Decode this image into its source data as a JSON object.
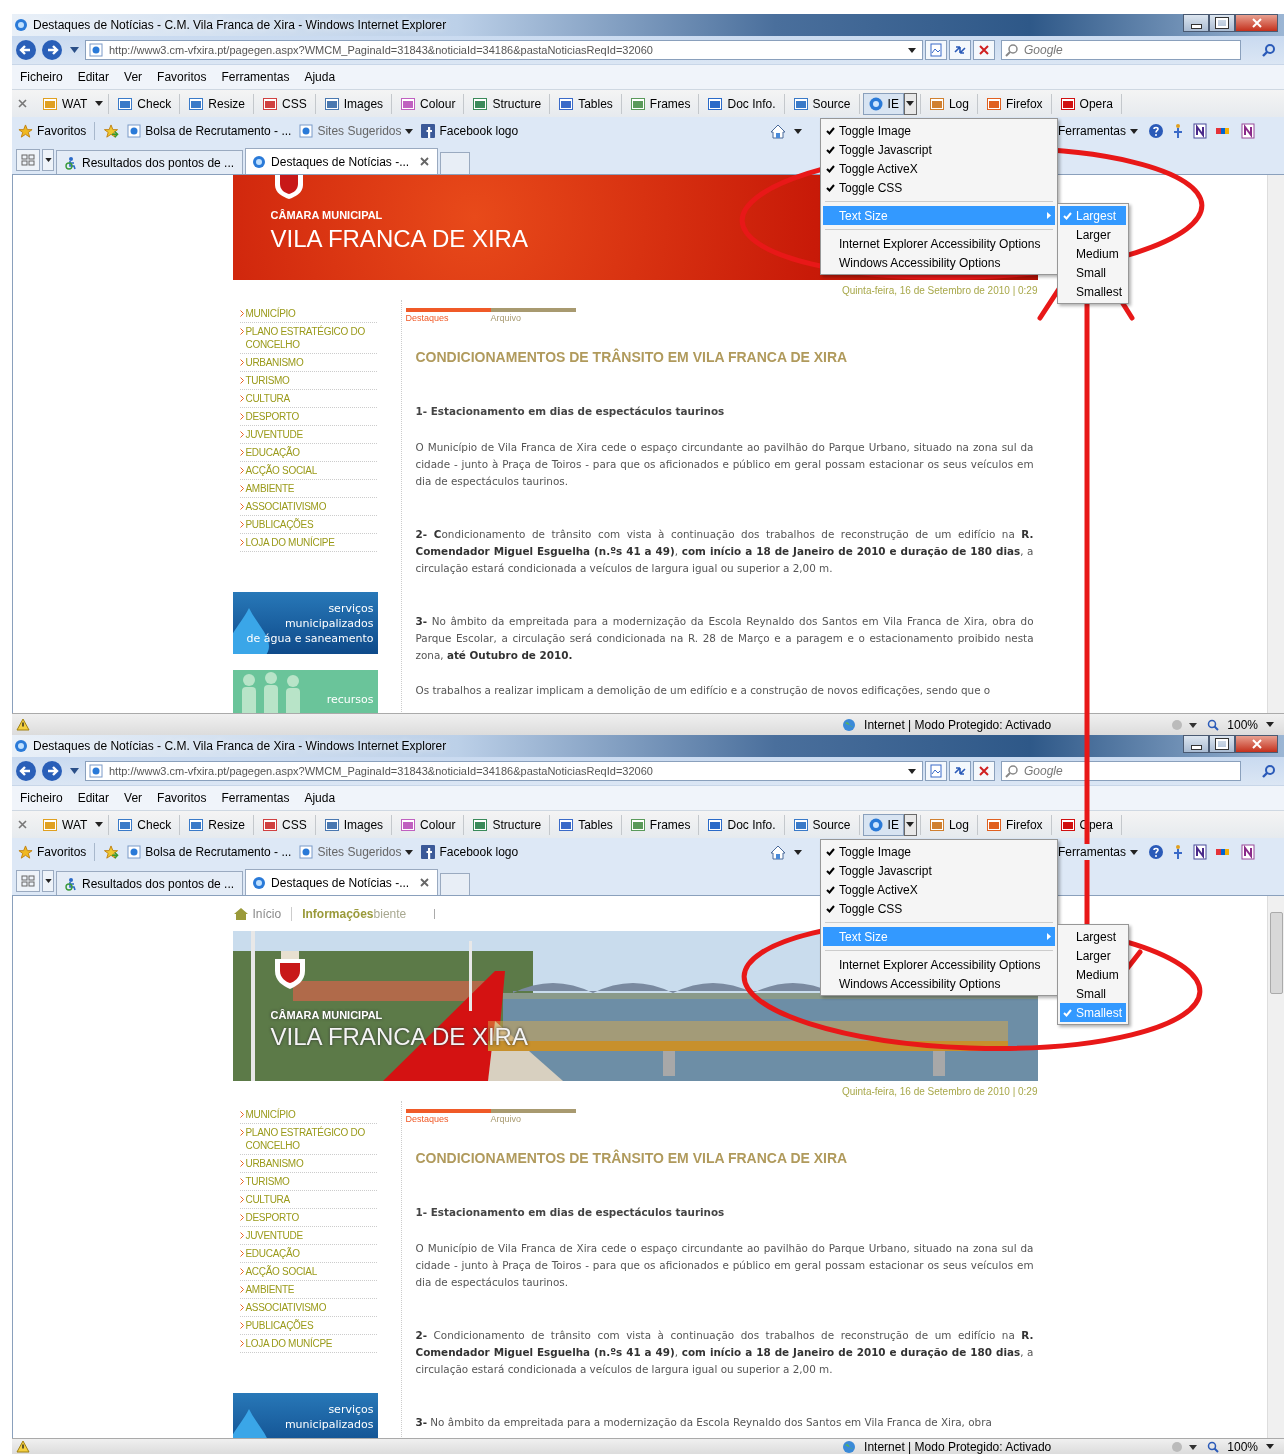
{
  "windows": [
    {
      "title": "Destaques de Notícias - C.M. Vila Franca de Xira - Windows Internet Explorer",
      "url": "http://www3.cm-vfxira.pt/pagegen.aspx?WMCM_PaginaId=31843&noticiaId=34186&pastaNoticiasReqId=32060",
      "search_placeholder": "Google",
      "menu": [
        "Ficheiro",
        "Editar",
        "Ver",
        "Favoritos",
        "Ferramentas",
        "Ajuda"
      ],
      "toolbar": [
        {
          "label": "WAT",
          "kind": "split",
          "pressed": false
        },
        {
          "label": "Check",
          "kind": "button",
          "pressed": false
        },
        {
          "label": "Resize",
          "kind": "button",
          "pressed": false
        },
        {
          "label": "CSS",
          "kind": "button",
          "pressed": false
        },
        {
          "label": "Images",
          "kind": "button",
          "pressed": false
        },
        {
          "label": "Colour",
          "kind": "button",
          "pressed": false
        },
        {
          "label": "Structure",
          "kind": "button",
          "pressed": false
        },
        {
          "label": "Tables",
          "kind": "button",
          "pressed": false
        },
        {
          "label": "Frames",
          "kind": "button",
          "pressed": false
        },
        {
          "label": "Doc Info.",
          "kind": "button",
          "pressed": false
        },
        {
          "label": "Source",
          "kind": "button",
          "pressed": false
        },
        {
          "label": "IE",
          "kind": "split",
          "pressed": true
        },
        {
          "label": "Log",
          "kind": "button",
          "pressed": false
        },
        {
          "label": "Firefox",
          "kind": "button",
          "pressed": false
        },
        {
          "label": "Opera",
          "kind": "button",
          "pressed": false
        }
      ],
      "favorites": [
        {
          "label": "Favoritos",
          "kind": "star"
        },
        {
          "label": "Bolsa de Recrutamento - ...",
          "kind": "page"
        },
        {
          "label": "Sites Sugeridos",
          "kind": "menu"
        },
        {
          "label": "Facebook logo",
          "kind": "facebook"
        }
      ],
      "tools_label": "Ferramentas",
      "tabs": [
        {
          "label": "Resultados dos pontos de ...",
          "selected": false
        },
        {
          "label": "Destaques de Notícias -...",
          "selected": true
        }
      ],
      "dropdown": {
        "items": [
          {
            "label": "Toggle Image",
            "kind": "toggle",
            "checked": true
          },
          {
            "label": "Toggle Javascript",
            "kind": "toggle",
            "checked": true
          },
          {
            "label": "Toggle ActiveX",
            "kind": "toggle",
            "checked": true
          },
          {
            "label": "Toggle CSS",
            "kind": "toggle",
            "checked": true
          },
          {
            "label": "Text Size",
            "kind": "submenu",
            "checked": false
          },
          {
            "label": "Internet Explorer Accessibility Options",
            "kind": "action",
            "checked": false
          },
          {
            "label": "Windows Accessibility Options",
            "kind": "action",
            "checked": false
          }
        ],
        "submenu": [
          {
            "label": "Largest",
            "checked": true
          },
          {
            "label": "Larger",
            "checked": false
          },
          {
            "label": "Medium",
            "checked": false
          },
          {
            "label": "Small",
            "checked": false
          },
          {
            "label": "Smallest",
            "checked": false
          }
        ]
      },
      "page": {
        "banner": {
          "kind": "texture",
          "line1": "CÂMARA MUNICIPAL",
          "line2": "VILA FRANCA DE XIRA"
        },
        "date": "Quinta-feira, 16 de Setembro de 2010 | 0:29",
        "sidebar": [
          "MUNICÍPIO",
          "PLANO ESTRATÉGICO DO CONCELHO",
          "URBANISMO",
          "TURISMO",
          "CULTURA",
          "DESPORTO",
          "JUVENTUDE",
          "EDUCAÇÃO",
          "ACÇÃO SOCIAL",
          "AMBIENTE",
          "ASSOCIATIVISMO",
          "PUBLICAÇÕES",
          "LOJA DO MUNÍCIPE"
        ],
        "promos": [
          {
            "kind": "water",
            "lines": [
              "serviços",
              "municipalizados",
              "de água e saneamento"
            ]
          },
          {
            "kind": "people",
            "lines": [
              "recursos"
            ]
          }
        ],
        "news_tabs": [
          {
            "label": "Destaques",
            "selected": true
          },
          {
            "label": "Arquivo",
            "selected": false
          }
        ],
        "heading": "CONDICIONAMENTOS DE TRÂNSITO EM VILA FRANCA DE XIRA",
        "paragraphs": [
          {
            "kind": "heading",
            "text": "1- Estacionamento em dias de espectáculos taurinos"
          },
          {
            "kind": "text",
            "text": "O Município de Vila Franca de Xira cede o espaço circundante ao pavilhão do Parque Urbano, situado na zona sul da cidade - junto à Praça de Toiros - para que os aficionados e público em geral possam estacionar os seus veículos em dia de espectáculos taurinos."
          },
          {
            "kind": "text",
            "text": "**2- C**ondicionamento de trânsito com vista à continuação dos trabalhos de reconstrução de um edifício na **R. Comendador Miguel Esguelha (n.ºs 41 a 49)**, **com início a 18 de Janeiro de 2010 e duração de 180 dias**, a circulação estará condicionada a veículos de largura igual ou superior a 2,00 m."
          },
          {
            "kind": "text",
            "text": "**3-** No âmbito da empreitada para a modernização da Escola Reynaldo dos Santos em Vila Franca de Xira, obra do Parque Escolar, a circulação será condicionada na R. 28 de Março e a paragem e o estacionamento proibido nesta zona, **até Outubro de 2010.**"
          },
          {
            "kind": "text",
            "text": "Os trabalhos a realizar implicam a demolição de um edifício e a construção de novos edificações, sendo que o"
          }
        ]
      },
      "status": {
        "zone": "Internet | Modo Protegido: Activado",
        "zoom": "100%"
      }
    },
    {
      "title": "Destaques de Notícias - C.M. Vila Franca de Xira - Windows Internet Explorer",
      "url": "http://www3.cm-vfxira.pt/pagegen.aspx?WMCM_PaginaId=31843&noticiaId=34186&pastaNoticiasReqId=32060",
      "search_placeholder": "Google",
      "menu": [
        "Ficheiro",
        "Editar",
        "Ver",
        "Favoritos",
        "Ferramentas",
        "Ajuda"
      ],
      "toolbar": [
        {
          "label": "WAT",
          "kind": "split",
          "pressed": false
        },
        {
          "label": "Check",
          "kind": "button",
          "pressed": false
        },
        {
          "label": "Resize",
          "kind": "button",
          "pressed": false
        },
        {
          "label": "CSS",
          "kind": "button",
          "pressed": false
        },
        {
          "label": "Images",
          "kind": "button",
          "pressed": false
        },
        {
          "label": "Colour",
          "kind": "button",
          "pressed": false
        },
        {
          "label": "Structure",
          "kind": "button",
          "pressed": false
        },
        {
          "label": "Tables",
          "kind": "button",
          "pressed": false
        },
        {
          "label": "Frames",
          "kind": "button",
          "pressed": false
        },
        {
          "label": "Doc Info.",
          "kind": "button",
          "pressed": false
        },
        {
          "label": "Source",
          "kind": "button",
          "pressed": false
        },
        {
          "label": "IE",
          "kind": "split",
          "pressed": true
        },
        {
          "label": "Log",
          "kind": "button",
          "pressed": false
        },
        {
          "label": "Firefox",
          "kind": "button",
          "pressed": false
        },
        {
          "label": "Opera",
          "kind": "button",
          "pressed": false
        }
      ],
      "favorites": [
        {
          "label": "Favoritos",
          "kind": "star"
        },
        {
          "label": "Bolsa de Recrutamento - ...",
          "kind": "page"
        },
        {
          "label": "Sites Sugeridos",
          "kind": "menu"
        },
        {
          "label": "Facebook logo",
          "kind": "facebook"
        }
      ],
      "tools_label": "Ferramentas",
      "tabs": [
        {
          "label": "Resultados dos pontos de ...",
          "selected": false
        },
        {
          "label": "Destaques de Notícias -...",
          "selected": true
        }
      ],
      "dropdown": {
        "items": [
          {
            "label": "Toggle Image",
            "kind": "toggle",
            "checked": true
          },
          {
            "label": "Toggle Javascript",
            "kind": "toggle",
            "checked": true
          },
          {
            "label": "Toggle ActiveX",
            "kind": "toggle",
            "checked": true
          },
          {
            "label": "Toggle CSS",
            "kind": "toggle",
            "checked": true
          },
          {
            "label": "Text Size",
            "kind": "submenu",
            "checked": false
          },
          {
            "label": "Internet Explorer Accessibility Options",
            "kind": "action",
            "checked": false
          },
          {
            "label": "Windows Accessibility Options",
            "kind": "action",
            "checked": false
          }
        ],
        "submenu": [
          {
            "label": "Largest",
            "checked": false
          },
          {
            "label": "Larger",
            "checked": false
          },
          {
            "label": "Medium",
            "checked": false
          },
          {
            "label": "Small",
            "checked": false
          },
          {
            "label": "Smallest",
            "checked": true
          }
        ]
      },
      "page": {
        "nav": [
          {
            "label": "Início",
            "kind": "home",
            "selected": false
          },
          {
            "label": "Informações",
            "kind": "link",
            "selected": true
          },
          {
            "label": "biente",
            "kind": "link",
            "selected": false
          }
        ],
        "banner": {
          "kind": "picture",
          "line1": "CÂMARA MUNICIPAL",
          "line2": "VILA FRANCA DE XIRA"
        },
        "date": "Quinta-feira, 16 de Setembro de 2010 | 0:29",
        "sidebar": [
          "MUNICÍPIO",
          "PLANO ESTRATÉGICO DO CONCELHO",
          "URBANISMO",
          "TURISMO",
          "CULTURA",
          "DESPORTO",
          "JUVENTUDE",
          "EDUCAÇÃO",
          "ACÇÃO SOCIAL",
          "AMBIENTE",
          "ASSOCIATIVISMO",
          "PUBLICAÇÕES",
          "LOJA DO MUNÍCPE"
        ],
        "promos": [
          {
            "kind": "water",
            "lines": [
              "serviços",
              "municipalizados"
            ]
          }
        ],
        "news_tabs": [
          {
            "label": "Destaques",
            "selected": true
          },
          {
            "label": "Arquivo",
            "selected": false
          }
        ],
        "heading": "CONDICIONAMENTOS DE TRÂNSITO EM VILA FRANCA DE XIRA",
        "paragraphs": [
          {
            "kind": "heading",
            "text": "1- Estacionamento em dias de espectáculos taurinos"
          },
          {
            "kind": "text",
            "text": "O Município de Vila Franca de Xira cede o espaço circundante ao pavilhão do Parque Urbano, situado na zona sul da cidade - junto à Praça de Toiros - para que os aficionados e público em geral possam estacionar os seus veículos em dia de espectáculos taurinos."
          },
          {
            "kind": "text",
            "text": "**2-** Condicionamento de trânsito com vista à continuação dos trabalhos de reconstrução de um edifício na **R. Comendador Miguel Esguelha (n.ºs 41 a 49)**, **com início a 18 de Janeiro de 2010 e duração de 180 dias**, a circulação estará condicionada a veículos de largura igual ou superior a 2,00 m."
          },
          {
            "kind": "text",
            "text": "**3-** No âmbito da empreitada para a modernização da Escola Reynaldo dos Santos em Vila Franca de Xira, obra"
          }
        ]
      },
      "status": {
        "zone": "Internet | Modo Protegido: Activado",
        "zoom": "100%"
      }
    }
  ]
}
